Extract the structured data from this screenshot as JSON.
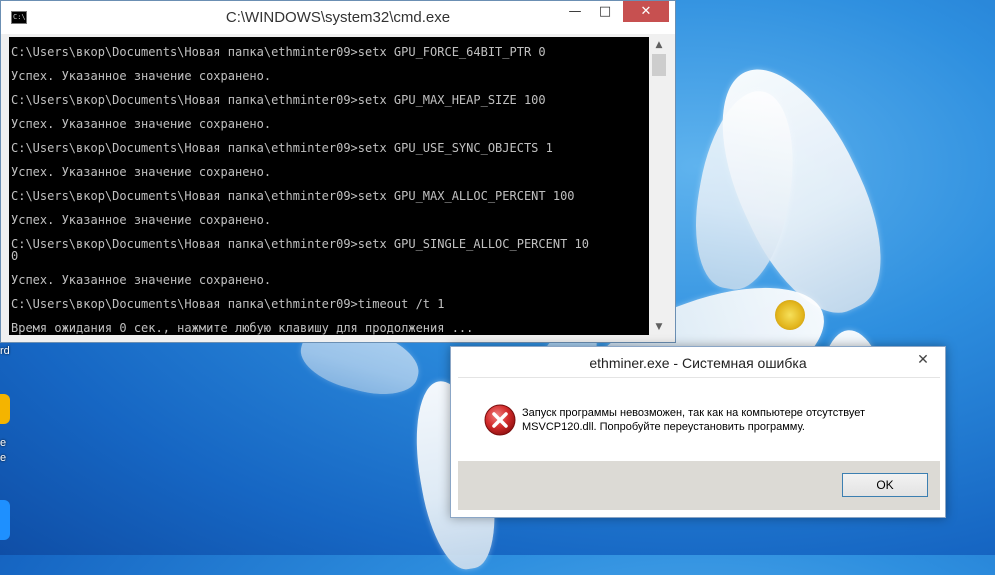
{
  "cmd": {
    "title": "C:\\WINDOWS\\system32\\cmd.exe",
    "icon_label": "C:\\",
    "lines": [
      "C:\\Users\\вкор\\Documents\\Новая папка\\ethminter09>setx GPU_FORCE_64BIT_PTR 0",
      "Успех. Указанное значение сохранено.",
      "C:\\Users\\вкор\\Documents\\Новая папка\\ethminter09>setx GPU_MAX_HEAP_SIZE 100",
      "Успех. Указанное значение сохранено.",
      "C:\\Users\\вкор\\Documents\\Новая папка\\ethminter09>setx GPU_USE_SYNC_OBJECTS 1",
      "Успех. Указанное значение сохранено.",
      "C:\\Users\\вкор\\Documents\\Новая папка\\ethminter09>setx GPU_MAX_ALLOC_PERCENT 100",
      "Успех. Указанное значение сохранено.",
      "C:\\Users\\вкор\\Documents\\Новая папка\\ethminter09>setx GPU_SINGLE_ALLOC_PERCENT 10",
      "0",
      "Успех. Указанное значение сохранено.",
      "C:\\Users\\вкор\\Documents\\Новая папка\\ethminter09>timeout /t 1",
      "Время ожидания 0 сек., нажмите любую клавишу для продолжения ..."
    ],
    "buttons": {
      "minimize": "—",
      "maximize": "□",
      "close": "✕"
    }
  },
  "dialog": {
    "title": "ethminer.exe - Системная ошибка",
    "message_line1": "Запуск программы невозможен, так как на компьютере отсутствует",
    "message_line2": "MSVCP120.dll. Попробуйте переустановить программу.",
    "ok_label": "OK",
    "close": "✕",
    "icon": "error-icon"
  },
  "desktop": {
    "fragments": [
      "rd",
      "e",
      "e"
    ]
  }
}
